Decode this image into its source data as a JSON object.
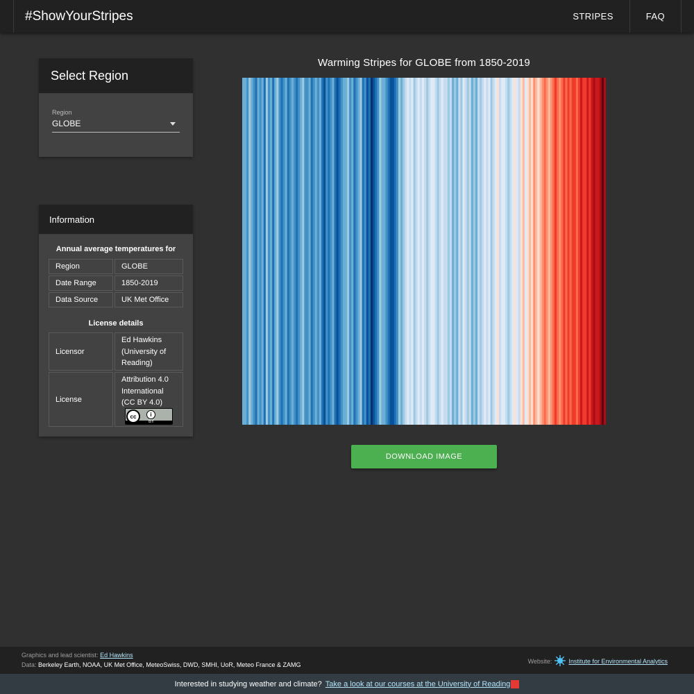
{
  "header": {
    "brand": "#ShowYourStripes",
    "nav": [
      "STRIPES",
      "FAQ"
    ]
  },
  "region_card": {
    "title": "Select Region",
    "select_label": "Region",
    "select_value": "GLOBE"
  },
  "info_card": {
    "title": "Information",
    "annual_heading": "Annual average temperatures for",
    "rows": [
      {
        "key": "Region",
        "value": "GLOBE"
      },
      {
        "key": "Date Range",
        "value": "1850-2019"
      },
      {
        "key": "Data Source",
        "value": "UK Met Office"
      }
    ],
    "license_heading": "License details",
    "licensor_key": "Licensor",
    "licensor_value": "Ed Hawkins (University of Reading)",
    "license_key": "License",
    "license_value": "Attribution 4.0 International (CC BY 4.0)",
    "cc_badge_text": "BY"
  },
  "main": {
    "stripes_title": "Warming Stripes for GLOBE from 1850-2019",
    "download_label": "DOWNLOAD IMAGE"
  },
  "stripes": {
    "start_year": 1850,
    "end_year": 2019,
    "palette": [
      "#08306b",
      "#08519c",
      "#2171b5",
      "#4292c6",
      "#6baed6",
      "#9ecae1",
      "#c6dbef",
      "#deebf7",
      "#fee0d2",
      "#fcbba1",
      "#fc9272",
      "#fb6a4a",
      "#ef3b2c",
      "#cb181d",
      "#a50f15",
      "#67000d"
    ],
    "levels": [
      4,
      4,
      3,
      5,
      4,
      3,
      2,
      4,
      3,
      4,
      2,
      5,
      3,
      4,
      2,
      4,
      5,
      3,
      2,
      3,
      4,
      2,
      3,
      4,
      3,
      2,
      3,
      4,
      5,
      3,
      3,
      4,
      2,
      3,
      4,
      3,
      4,
      2,
      1,
      3,
      2,
      3,
      4,
      2,
      1,
      2,
      3,
      4,
      4,
      5,
      3,
      4,
      2,
      3,
      4,
      5,
      2,
      3,
      1,
      2,
      0,
      1,
      2,
      3,
      5,
      4,
      4,
      3,
      2,
      1,
      1,
      2,
      3,
      5,
      4,
      5,
      6,
      7,
      6,
      7,
      5,
      6,
      7,
      6,
      7,
      6,
      5,
      6,
      7,
      7,
      6,
      5,
      6,
      7,
      6,
      6,
      5,
      6,
      4,
      5,
      4,
      6,
      5,
      7,
      6,
      5,
      6,
      4,
      5,
      4,
      6,
      5,
      6,
      7,
      6,
      7,
      5,
      6,
      7,
      8,
      6,
      7,
      7,
      6,
      5,
      6,
      7,
      8,
      7,
      6,
      8,
      9,
      7,
      8,
      9,
      8,
      10,
      9,
      8,
      9,
      10,
      11,
      10,
      9,
      10,
      11,
      12,
      11,
      10,
      11,
      12,
      11,
      12,
      11,
      12,
      12,
      11,
      12,
      13,
      12,
      12,
      13,
      12,
      13,
      14,
      13,
      13,
      14,
      15,
      14
    ]
  },
  "footer": {
    "graphics_label": "Graphics and lead scientist:",
    "graphics_name": "Ed Hawkins",
    "data_label": "Data:",
    "data_sources": "Berkeley Earth, NOAA, UK Met Office, MeteoSwiss, DWD, SMHI, UoR, Meteo France & ZAMG",
    "website_label": "Website:",
    "website_name": "Institute for Environmental Analytics"
  },
  "banner": {
    "text": "Interested in studying weather and climate?",
    "link": "Take a look at our courses at the University of Reading"
  }
}
